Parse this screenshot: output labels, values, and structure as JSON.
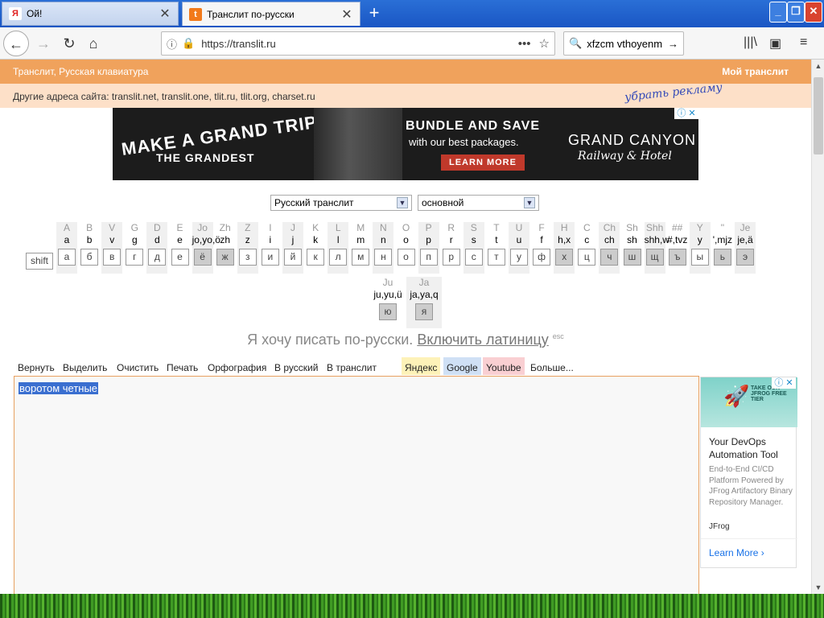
{
  "browser": {
    "tabs": [
      {
        "title": "Ой!",
        "icon": "Я",
        "icon_color": "#e02020"
      },
      {
        "title": "Транслит по-русски",
        "icon": "t",
        "icon_color": "#f27a1a"
      }
    ],
    "new_tab": "+",
    "window_buttons": [
      "_",
      "❐",
      "✕"
    ],
    "url": "https://translit.ru",
    "search_text": "xfzcm vthoyenm"
  },
  "header": {
    "left": "Транслит, Русская клавиатура",
    "right": "Мой транслит",
    "other_sites": "Другие адреса сайта: translit.net, translit.one, tlit.ru, tlit.org, charset.ru",
    "remove_ads": "убрать рекламу"
  },
  "banner_ad": {
    "headline1": "MAKE A GRAND TRIP",
    "headline2": "THE GRANDEST",
    "offer1": "BUNDLE AND SAVE",
    "offer2": "with our best packages.",
    "cta": "LEARN MORE",
    "brand1": "GRAND CANYON",
    "brand2": "Railway & Hotel",
    "ad_badge": "ⓘ ✕"
  },
  "selects": {
    "layout": "Русский транслит",
    "mode": "основной"
  },
  "keyboard": {
    "shift": "shift",
    "keys": [
      {
        "t": "A",
        "m": "a",
        "k": "а",
        "shade": true,
        "dark": false
      },
      {
        "t": "B",
        "m": "b",
        "k": "б",
        "shade": false,
        "dark": false
      },
      {
        "t": "V",
        "m": "v",
        "k": "в",
        "shade": true,
        "dark": false
      },
      {
        "t": "G",
        "m": "g",
        "k": "г",
        "shade": false,
        "dark": false
      },
      {
        "t": "D",
        "m": "d",
        "k": "д",
        "shade": true,
        "dark": false
      },
      {
        "t": "E",
        "m": "e",
        "k": "е",
        "shade": false,
        "dark": false
      },
      {
        "t": "Jo",
        "m": "jo,yo,ö",
        "k": "ё",
        "shade": true,
        "dark": true
      },
      {
        "t": "Zh",
        "m": "zh",
        "k": "ж",
        "shade": false,
        "dark": true
      },
      {
        "t": "Z",
        "m": "z",
        "k": "з",
        "shade": true,
        "dark": false
      },
      {
        "t": "I",
        "m": "i",
        "k": "и",
        "shade": false,
        "dark": false
      },
      {
        "t": "J",
        "m": "j",
        "k": "й",
        "shade": true,
        "dark": false
      },
      {
        "t": "K",
        "m": "k",
        "k": "к",
        "shade": false,
        "dark": false
      },
      {
        "t": "L",
        "m": "l",
        "k": "л",
        "shade": true,
        "dark": false
      },
      {
        "t": "M",
        "m": "m",
        "k": "м",
        "shade": false,
        "dark": false
      },
      {
        "t": "N",
        "m": "n",
        "k": "н",
        "shade": true,
        "dark": false
      },
      {
        "t": "O",
        "m": "o",
        "k": "о",
        "shade": false,
        "dark": false
      },
      {
        "t": "P",
        "m": "p",
        "k": "п",
        "shade": true,
        "dark": false
      },
      {
        "t": "R",
        "m": "r",
        "k": "р",
        "shade": false,
        "dark": false
      },
      {
        "t": "S",
        "m": "s",
        "k": "с",
        "shade": true,
        "dark": false
      },
      {
        "t": "T",
        "m": "t",
        "k": "т",
        "shade": false,
        "dark": false
      },
      {
        "t": "U",
        "m": "u",
        "k": "у",
        "shade": true,
        "dark": false
      },
      {
        "t": "F",
        "m": "f",
        "k": "ф",
        "shade": false,
        "dark": false
      },
      {
        "t": "H",
        "m": "h,x",
        "k": "х",
        "shade": true,
        "dark": true
      },
      {
        "t": "C",
        "m": "c",
        "k": "ц",
        "shade": false,
        "dark": false
      },
      {
        "t": "Ch",
        "m": "ch",
        "k": "ч",
        "shade": true,
        "dark": true
      },
      {
        "t": "Sh",
        "m": "sh",
        "k": "ш",
        "shade": false,
        "dark": true
      },
      {
        "t": "Shh",
        "m": "shh,w",
        "k": "щ",
        "shade": true,
        "dark": true
      },
      {
        "t": "##",
        "m": "#,tvz",
        "k": "ъ",
        "shade": false,
        "dark": true
      },
      {
        "t": "Y",
        "m": "y",
        "k": "ы",
        "shade": true,
        "dark": false
      },
      {
        "t": "''",
        "m": "',mjz",
        "k": "ь",
        "shade": false,
        "dark": true
      },
      {
        "t": "Je",
        "m": "je,ä",
        "k": "э",
        "shade": true,
        "dark": true
      }
    ],
    "row2": [
      {
        "t": "Ju",
        "m": "ju,yu,ü",
        "k": "ю",
        "shade": false,
        "dark": true
      },
      {
        "t": "Ja",
        "m": "ja,ya,q",
        "k": "я",
        "shade": true,
        "dark": true
      }
    ]
  },
  "slogan": {
    "text": "Я хочу писать по-русски.",
    "link": "Включить латиницу",
    "sup": "esc"
  },
  "toolbar": {
    "items": [
      "Вернуть",
      "Выделить",
      "Очистить",
      "Печать",
      "Орфография",
      "В русский",
      "В транслит"
    ],
    "yandex": "Яндекс",
    "google": "Google",
    "youtube": "Youtube",
    "more": "Больше..."
  },
  "editor": {
    "text": "воротом четные"
  },
  "side_ad": {
    "title": "Your DevOps Automation Tool",
    "desc": "End-to-End CI/CD Platform Powered by JFrog Artifactory Binary Repository Manager.",
    "brand": "JFrog",
    "cta": "Learn More",
    "img_text": "TAKE OUR JFROG FREE TIER",
    "ad_badge": "ⓘ ✕"
  }
}
